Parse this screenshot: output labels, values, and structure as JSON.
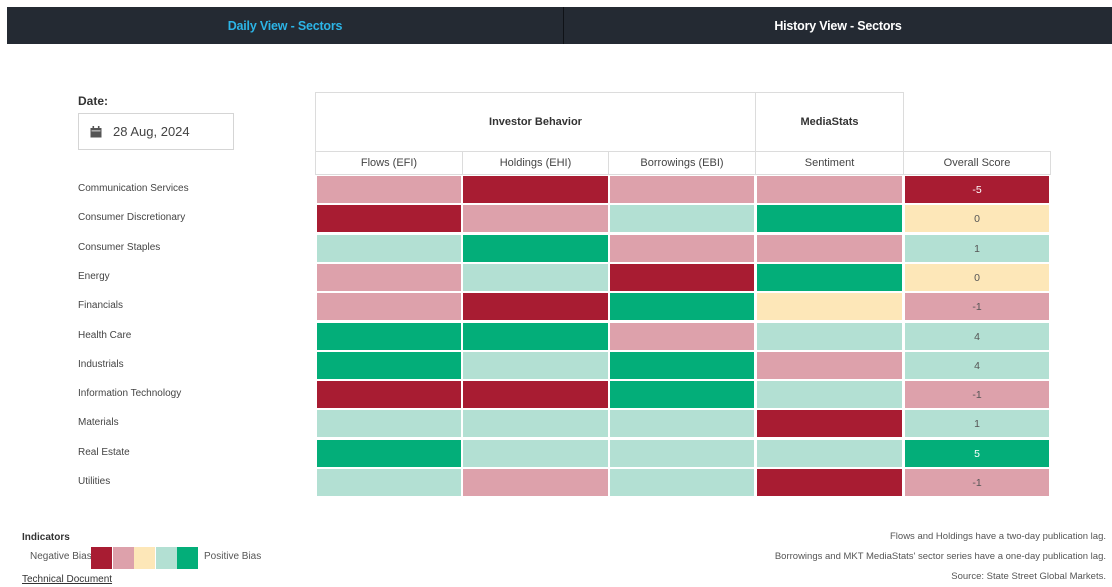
{
  "tabs": {
    "daily": "Daily View - Sectors",
    "history": "History View - Sectors"
  },
  "date": {
    "label": "Date:",
    "value": "28 Aug, 2024",
    "icon": "calendar-icon"
  },
  "groups": {
    "investor_behavior": "Investor Behavior",
    "mediastats": "MediaStats"
  },
  "columns": [
    "Flows (EFI)",
    "Holdings (EHI)",
    "Borrowings (EBI)",
    "Sentiment",
    "Overall Score"
  ],
  "colors": {
    "strong_negative": "#a81c32",
    "negative": "#dda1ab",
    "neutral": "#fde7b8",
    "positive": "#b3e0d3",
    "strong_positive": "#03ae79"
  },
  "rows": [
    {
      "label": "Communication Services",
      "cells": [
        "negative",
        "strong_negative",
        "negative",
        "negative"
      ],
      "score": "-5",
      "score_level": "strong_negative"
    },
    {
      "label": "Consumer Discretionary",
      "cells": [
        "strong_negative",
        "negative",
        "positive",
        "strong_positive"
      ],
      "score": "0",
      "score_level": "neutral"
    },
    {
      "label": "Consumer Staples",
      "cells": [
        "positive",
        "strong_positive",
        "negative",
        "negative"
      ],
      "score": "1",
      "score_level": "positive"
    },
    {
      "label": "Energy",
      "cells": [
        "negative",
        "positive",
        "strong_negative",
        "strong_positive"
      ],
      "score": "0",
      "score_level": "neutral"
    },
    {
      "label": "Financials",
      "cells": [
        "negative",
        "strong_negative",
        "strong_positive",
        "neutral"
      ],
      "score": "-1",
      "score_level": "negative"
    },
    {
      "label": "Health Care",
      "cells": [
        "strong_positive",
        "strong_positive",
        "negative",
        "positive"
      ],
      "score": "4",
      "score_level": "positive"
    },
    {
      "label": "Industrials",
      "cells": [
        "strong_positive",
        "positive",
        "strong_positive",
        "negative"
      ],
      "score": "4",
      "score_level": "positive"
    },
    {
      "label": "Information Technology",
      "cells": [
        "strong_negative",
        "strong_negative",
        "strong_positive",
        "positive"
      ],
      "score": "-1",
      "score_level": "negative"
    },
    {
      "label": "Materials",
      "cells": [
        "positive",
        "positive",
        "positive",
        "strong_negative"
      ],
      "score": "1",
      "score_level": "positive"
    },
    {
      "label": "Real Estate",
      "cells": [
        "strong_positive",
        "positive",
        "positive",
        "positive"
      ],
      "score": "5",
      "score_level": "strong_positive"
    },
    {
      "label": "Utilities",
      "cells": [
        "positive",
        "negative",
        "positive",
        "strong_negative"
      ],
      "score": "-1",
      "score_level": "negative"
    }
  ],
  "legend": {
    "title": "Indicators",
    "negative": "Negative Bias",
    "positive": "Positive Bias",
    "scale": [
      "strong_negative",
      "negative",
      "neutral",
      "positive",
      "strong_positive"
    ],
    "tech_doc": "Technical Document"
  },
  "notes": [
    "Flows and Holdings have a two-day publication lag.",
    "Borrowings and MKT MediaStats' sector series have a one-day publication lag.",
    "Source: State Street Global Markets."
  ]
}
